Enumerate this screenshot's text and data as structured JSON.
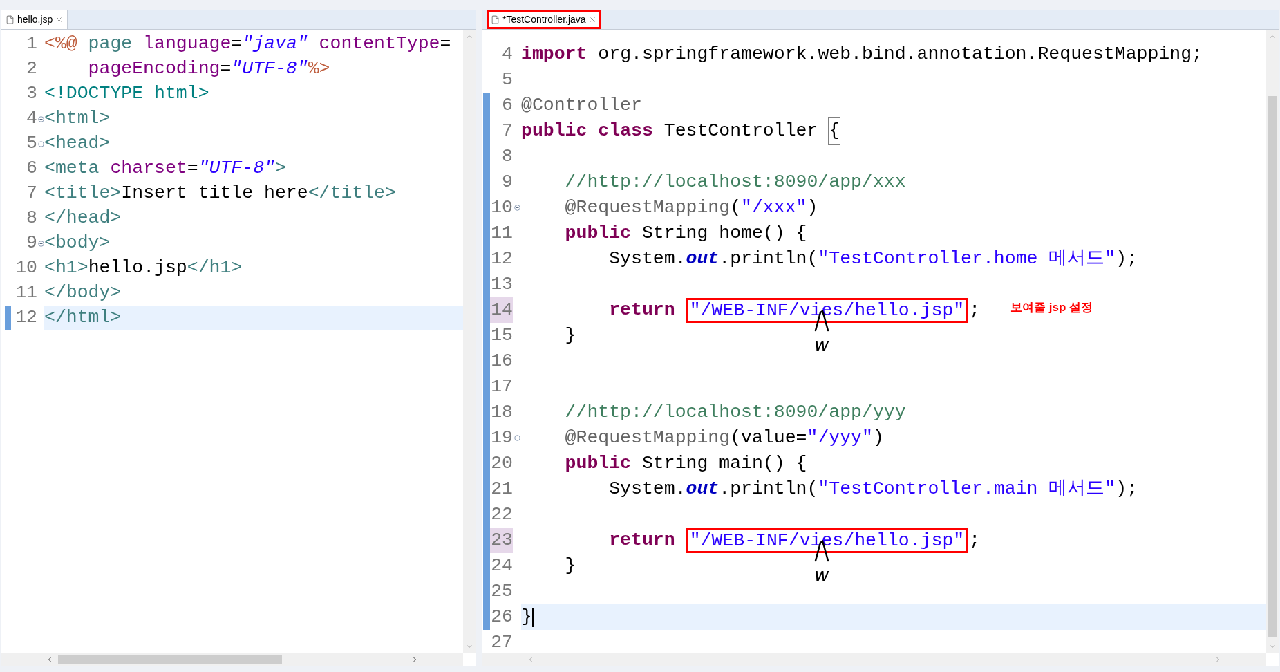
{
  "editors": [
    {
      "tab": {
        "title": "hello.jsp",
        "highlighted": false
      },
      "focused": false,
      "lines": [
        {
          "number": "1",
          "current": false,
          "changed": false,
          "marked": false,
          "fold": false,
          "tokens": [
            {
              "kind": "jsp-delim",
              "text": "<%@"
            },
            {
              "kind": "directive",
              "text": " page"
            },
            {
              "kind": "attr",
              "text": " language"
            },
            {
              "kind": "plain",
              "text": "="
            },
            {
              "kind": "value",
              "text": "\"java\""
            },
            {
              "kind": "attr",
              "text": " contentType"
            },
            {
              "kind": "plain",
              "text": "="
            }
          ]
        },
        {
          "number": "2",
          "current": false,
          "changed": false,
          "marked": false,
          "fold": false,
          "tokens": [
            {
              "kind": "attr",
              "text": "    pageEncoding"
            },
            {
              "kind": "plain",
              "text": "="
            },
            {
              "kind": "value",
              "text": "\"UTF-8\""
            },
            {
              "kind": "jsp-delim",
              "text": "%>"
            }
          ]
        },
        {
          "number": "3",
          "current": false,
          "changed": false,
          "marked": false,
          "fold": false,
          "tokens": [
            {
              "kind": "doctype",
              "text": "<!DOCTYPE html>"
            }
          ]
        },
        {
          "number": "4",
          "current": false,
          "changed": false,
          "marked": false,
          "fold": true,
          "tokens": [
            {
              "kind": "tag",
              "text": "<html>"
            }
          ]
        },
        {
          "number": "5",
          "current": false,
          "changed": false,
          "marked": false,
          "fold": true,
          "tokens": [
            {
              "kind": "tag",
              "text": "<head>"
            }
          ]
        },
        {
          "number": "6",
          "current": false,
          "changed": false,
          "marked": false,
          "fold": false,
          "tokens": [
            {
              "kind": "tag",
              "text": "<meta"
            },
            {
              "kind": "attr",
              "text": " charset"
            },
            {
              "kind": "plain",
              "text": "="
            },
            {
              "kind": "value",
              "text": "\"UTF-8\""
            },
            {
              "kind": "tag",
              "text": ">"
            }
          ]
        },
        {
          "number": "7",
          "current": false,
          "changed": false,
          "marked": false,
          "fold": false,
          "tokens": [
            {
              "kind": "tag",
              "text": "<title>"
            },
            {
              "kind": "plain",
              "text": "Insert title here"
            },
            {
              "kind": "tag",
              "text": "</title>"
            }
          ]
        },
        {
          "number": "8",
          "current": false,
          "changed": false,
          "marked": false,
          "fold": false,
          "tokens": [
            {
              "kind": "tag",
              "text": "</head>"
            }
          ]
        },
        {
          "number": "9",
          "current": false,
          "changed": false,
          "marked": false,
          "fold": true,
          "tokens": [
            {
              "kind": "tag",
              "text": "<body>"
            }
          ]
        },
        {
          "number": "10",
          "current": false,
          "changed": false,
          "marked": false,
          "fold": false,
          "tokens": [
            {
              "kind": "tag",
              "text": "<h1>"
            },
            {
              "kind": "plain",
              "text": "hello.jsp"
            },
            {
              "kind": "tag",
              "text": "</h1>"
            }
          ]
        },
        {
          "number": "11",
          "current": false,
          "changed": false,
          "marked": false,
          "fold": false,
          "tokens": [
            {
              "kind": "tag",
              "text": "</body>"
            }
          ]
        },
        {
          "number": "12",
          "current": true,
          "changed": true,
          "marked": false,
          "fold": false,
          "tokens": [
            {
              "kind": "tag",
              "text": "</html>"
            }
          ]
        }
      ]
    },
    {
      "tab": {
        "title": "*TestController.java",
        "highlighted": true
      },
      "focused": true,
      "lines": [
        {
          "number": "4",
          "current": false,
          "changed": false,
          "marked": false,
          "fold": false,
          "tokens": [
            {
              "kind": "keyword",
              "text": "import"
            },
            {
              "kind": "plain",
              "text": " org.springframework.web.bind.annotation.RequestMapping;"
            }
          ]
        },
        {
          "number": "5",
          "current": false,
          "changed": false,
          "marked": false,
          "fold": false
        },
        {
          "number": "6",
          "current": false,
          "changed": true,
          "marked": false,
          "fold": false,
          "tokens": [
            {
              "kind": "annotation",
              "text": "@Controller"
            }
          ]
        },
        {
          "number": "7",
          "current": false,
          "changed": true,
          "marked": false,
          "fold": false,
          "tokens": [
            {
              "kind": "keyword",
              "text": "public"
            },
            {
              "kind": "keyword",
              "text": " class"
            },
            {
              "kind": "plain",
              "text": " TestController "
            },
            {
              "kind": "bracket-match",
              "text": "{"
            }
          ]
        },
        {
          "number": "8",
          "current": false,
          "changed": true,
          "marked": false,
          "fold": false
        },
        {
          "number": "9",
          "current": false,
          "changed": true,
          "marked": false,
          "fold": false,
          "tokens": [
            {
              "kind": "comment",
              "text": "    //http://localhost:8090/app/xxx"
            }
          ]
        },
        {
          "number": "10",
          "current": false,
          "changed": true,
          "marked": false,
          "fold": true,
          "tokens": [
            {
              "kind": "annotation",
              "text": "    @RequestMapping"
            },
            {
              "kind": "plain",
              "text": "("
            },
            {
              "kind": "string",
              "text": "\"/xxx\""
            },
            {
              "kind": "plain",
              "text": ")"
            }
          ]
        },
        {
          "number": "11",
          "current": false,
          "changed": true,
          "marked": false,
          "fold": false,
          "tokens": [
            {
              "kind": "keyword",
              "text": "    public"
            },
            {
              "kind": "plain",
              "text": " String home() {"
            }
          ]
        },
        {
          "number": "12",
          "current": false,
          "changed": true,
          "marked": false,
          "fold": false,
          "tokens": [
            {
              "kind": "plain",
              "text": "        System."
            },
            {
              "kind": "field",
              "text": "out"
            },
            {
              "kind": "plain",
              "text": ".println("
            },
            {
              "kind": "string",
              "text": "\"TestController.home 메서드\""
            },
            {
              "kind": "plain",
              "text": ");"
            }
          ]
        },
        {
          "number": "13",
          "current": false,
          "changed": true,
          "marked": false,
          "fold": false
        },
        {
          "number": "14",
          "current": false,
          "changed": true,
          "marked": true,
          "fold": false,
          "note": "보여줄 jsp 설정",
          "scribble": "w",
          "tokens": [
            {
              "kind": "keyword",
              "text": "        return"
            },
            {
              "kind": "boxed-string",
              "text": "\"/WEB-INF/vies/hello.jsp\""
            },
            {
              "kind": "plain",
              "text": ";"
            }
          ]
        },
        {
          "number": "15",
          "current": false,
          "changed": true,
          "marked": false,
          "fold": false,
          "tokens": [
            {
              "kind": "plain",
              "text": "    }"
            }
          ]
        },
        {
          "number": "16",
          "current": false,
          "changed": true,
          "marked": false,
          "fold": false
        },
        {
          "number": "17",
          "current": false,
          "changed": true,
          "marked": false,
          "fold": false
        },
        {
          "number": "18",
          "current": false,
          "changed": true,
          "marked": false,
          "fold": false,
          "tokens": [
            {
              "kind": "comment",
              "text": "    //http://localhost:8090/app/yyy"
            }
          ]
        },
        {
          "number": "19",
          "current": false,
          "changed": true,
          "marked": false,
          "fold": true,
          "tokens": [
            {
              "kind": "annotation",
              "text": "    @RequestMapping"
            },
            {
              "kind": "plain",
              "text": "(value="
            },
            {
              "kind": "string",
              "text": "\"/yyy\""
            },
            {
              "kind": "plain",
              "text": ")"
            }
          ]
        },
        {
          "number": "20",
          "current": false,
          "changed": true,
          "marked": false,
          "fold": false,
          "tokens": [
            {
              "kind": "keyword",
              "text": "    public"
            },
            {
              "kind": "plain",
              "text": " String main() {"
            }
          ]
        },
        {
          "number": "21",
          "current": false,
          "changed": true,
          "marked": false,
          "fold": false,
          "tokens": [
            {
              "kind": "plain",
              "text": "        System."
            },
            {
              "kind": "field",
              "text": "out"
            },
            {
              "kind": "plain",
              "text": ".println("
            },
            {
              "kind": "string",
              "text": "\"TestController.main 메서드\""
            },
            {
              "kind": "plain",
              "text": ");"
            }
          ]
        },
        {
          "number": "22",
          "current": false,
          "changed": true,
          "marked": false,
          "fold": false
        },
        {
          "number": "23",
          "current": false,
          "changed": true,
          "marked": true,
          "fold": false,
          "scribble": "w",
          "tokens": [
            {
              "kind": "keyword",
              "text": "        return"
            },
            {
              "kind": "boxed-string",
              "text": "\"/WEB-INF/vies/hello.jsp\""
            },
            {
              "kind": "plain",
              "text": ";"
            }
          ]
        },
        {
          "number": "24",
          "current": false,
          "changed": true,
          "marked": false,
          "fold": false,
          "tokens": [
            {
              "kind": "plain",
              "text": "    }"
            }
          ]
        },
        {
          "number": "25",
          "current": false,
          "changed": true,
          "marked": false,
          "fold": false
        },
        {
          "number": "26",
          "current": true,
          "changed": true,
          "marked": false,
          "fold": false,
          "tokens": [
            {
              "kind": "plain",
              "text": "}"
            }
          ]
        },
        {
          "number": "27",
          "current": false,
          "changed": false,
          "marked": false,
          "fold": false
        }
      ]
    }
  ]
}
